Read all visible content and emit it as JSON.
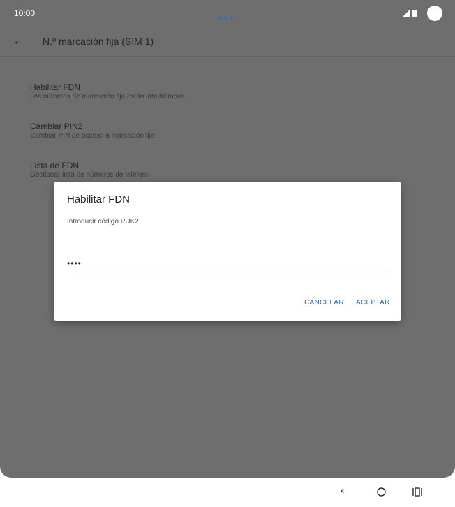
{
  "status_bar": {
    "time": "10:00"
  },
  "app_bar": {
    "title": "N.º marcación fija (SIM 1)"
  },
  "settings": [
    {
      "title": "Habilitar FDN",
      "subtitle": "Los números de marcación fija están inhabilitados"
    },
    {
      "title": "Cambiar PIN2",
      "subtitle": "Cambiar PIN de acceso a marcación fija"
    },
    {
      "title": "Lista de FDN",
      "subtitle": "Gestionar lista de números de teléfono"
    }
  ],
  "dialog": {
    "title": "Habilitar FDN",
    "message": "Introducir código PUK2",
    "input_value": "••••",
    "cancel_label": "CANCELAR",
    "ok_label": "ACEPTAR"
  },
  "icons": [
    "back-arrow-icon",
    "signal-icon",
    "battery-icon",
    "nav-back-icon",
    "nav-home-icon",
    "nav-recents-icon"
  ],
  "colors": {
    "accent": "#2f64ad",
    "scrim": "#6e6e6e"
  }
}
